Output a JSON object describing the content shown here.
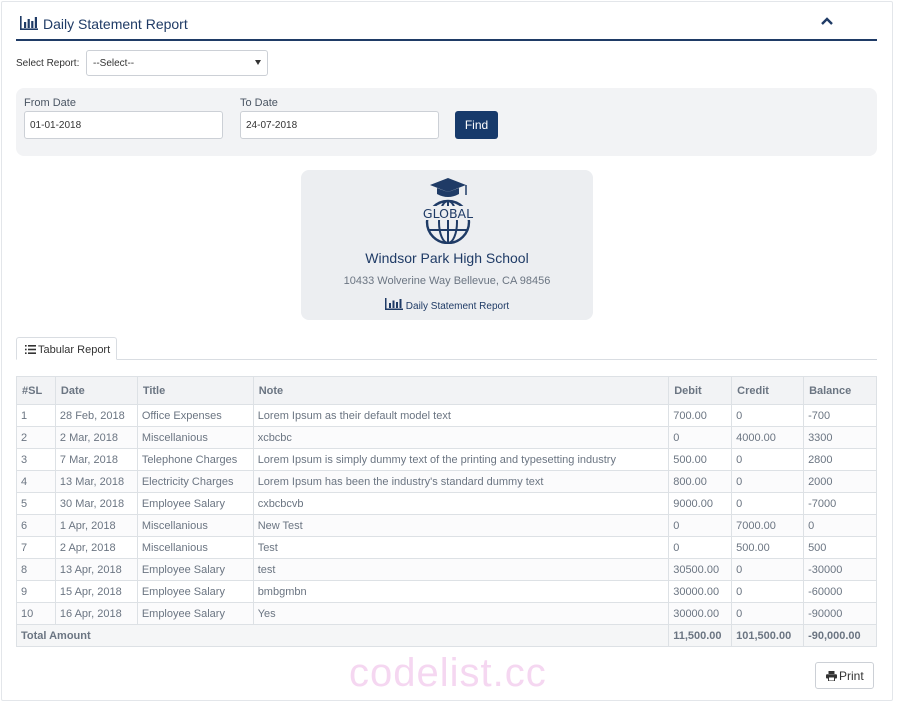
{
  "header": {
    "title": "Daily Statement Report"
  },
  "select_report": {
    "label": "Select Report:",
    "value": "--Select--"
  },
  "filter": {
    "from_label": "From Date",
    "from_value": "01-01-2018",
    "to_label": "To Date",
    "to_value": "24-07-2018",
    "find_label": "Find"
  },
  "school": {
    "logo_text": "GLOBAL",
    "name": "Windsor Park High School",
    "address": "10433 Wolverine Way Bellevue, CA 98456",
    "report_title": "Daily Statement Report"
  },
  "tabs": [
    {
      "label": "Tabular Report"
    }
  ],
  "table": {
    "columns": [
      "#SL",
      "Date",
      "Title",
      "Note",
      "Debit",
      "Credit",
      "Balance"
    ],
    "rows": [
      [
        "1",
        "28 Feb, 2018",
        "Office Expenses",
        "Lorem Ipsum as their default model text",
        "700.00",
        "0",
        "-700"
      ],
      [
        "2",
        "2 Mar, 2018",
        "Miscellanious",
        "xcbcbc",
        "0",
        "4000.00",
        "3300"
      ],
      [
        "3",
        "7 Mar, 2018",
        "Telephone Charges",
        "Lorem Ipsum is simply dummy text of the printing and typesetting industry",
        "500.00",
        "0",
        "2800"
      ],
      [
        "4",
        "13 Mar, 2018",
        "Electricity Charges",
        "Lorem Ipsum has been the industry's standard dummy text",
        "800.00",
        "0",
        "2000"
      ],
      [
        "5",
        "30 Mar, 2018",
        "Employee Salary",
        "cxbcbcvb",
        "9000.00",
        "0",
        "-7000"
      ],
      [
        "6",
        "1 Apr, 2018",
        "Miscellanious",
        "New Test",
        "0",
        "7000.00",
        "0"
      ],
      [
        "7",
        "2 Apr, 2018",
        "Miscellanious",
        "Test",
        "0",
        "500.00",
        "500"
      ],
      [
        "8",
        "13 Apr, 2018",
        "Employee Salary",
        "test",
        "30500.00",
        "0",
        "-30000"
      ],
      [
        "9",
        "15 Apr, 2018",
        "Employee Salary",
        "bmbgmbn",
        "30000.00",
        "0",
        "-60000"
      ],
      [
        "10",
        "16 Apr, 2018",
        "Employee Salary",
        "Yes",
        "30000.00",
        "0",
        "-90000"
      ]
    ],
    "total": {
      "label": "Total Amount",
      "debit": "11,500.00",
      "credit": "101,500.00",
      "balance": "-90,000.00"
    }
  },
  "print": {
    "label": "Print"
  },
  "watermark": "codelist.cc",
  "colors": {
    "primary": "#1f3b66",
    "button": "#173a6b",
    "panel_bg": "#f2f3f5"
  }
}
